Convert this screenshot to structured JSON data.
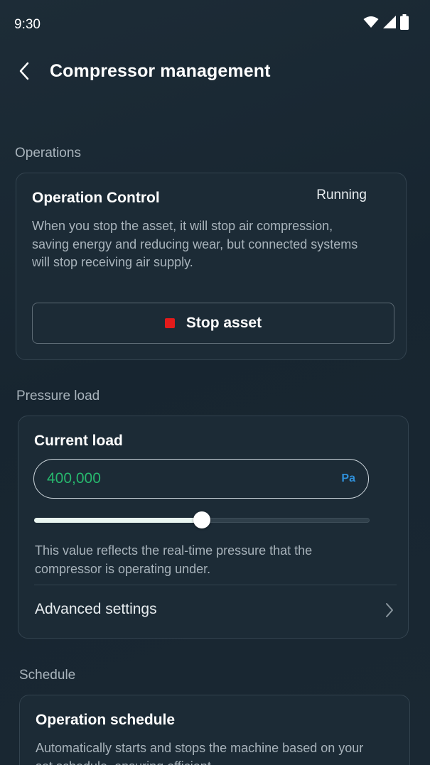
{
  "status_bar": {
    "time": "9:30"
  },
  "header": {
    "title": "Compressor management"
  },
  "operations": {
    "section_label": "Operations",
    "card_title": "Operation Control",
    "status": "Running",
    "description": "When you stop the asset, it will stop air compression, saving energy and reducing wear, but connected systems will stop receiving air supply.",
    "stop_label": "Stop asset",
    "stop_color": "#e31b1b"
  },
  "pressure": {
    "section_label": "Pressure load",
    "card_title": "Current load",
    "value": "400,000",
    "unit": "Pa",
    "slider_fraction": 0.5,
    "description": "This value reflects the real-time pressure that the compressor is operating under.",
    "advanced_label": "Advanced settings"
  },
  "schedule": {
    "section_label": "Schedule",
    "card_title": "Operation schedule",
    "description": "Automatically starts and stops the machine based on your set schedule, ensuring efficient"
  },
  "colors": {
    "accent_green": "#27b86e",
    "unit_blue": "#2f8fd8",
    "background": "#182530"
  },
  "icons": [
    "wifi-icon",
    "cellular-signal-icon",
    "battery-icon",
    "back-arrow-icon",
    "stop-icon",
    "chevron-right-icon"
  ]
}
